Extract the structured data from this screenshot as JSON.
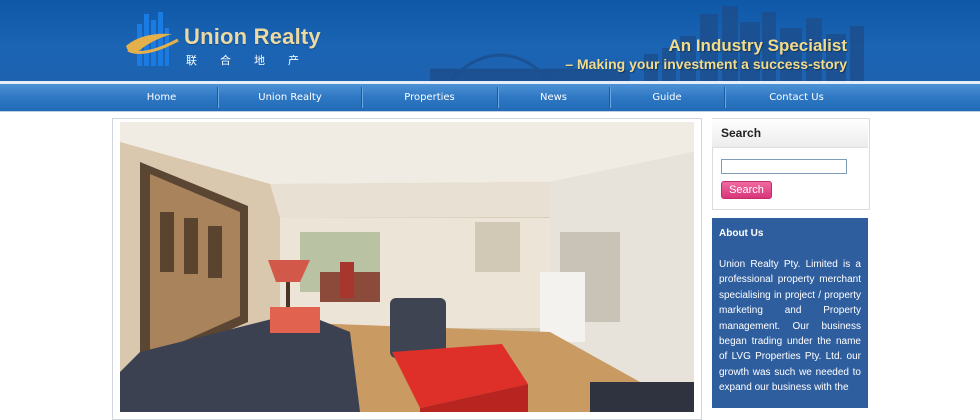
{
  "brand": {
    "name": "Union Realty",
    "chinese_name": "联合地产"
  },
  "header": {
    "tagline_title": "An Industry Specialist",
    "tagline_sub": "– Making your investment a success-story",
    "accent_color": "#ecd9a2",
    "background_color": "#1b64b4"
  },
  "nav": {
    "items": [
      {
        "label": "Home"
      },
      {
        "label": "Union Realty"
      },
      {
        "label": "Properties"
      },
      {
        "label": "News"
      },
      {
        "label": "Guide"
      },
      {
        "label": "Contact Us"
      }
    ]
  },
  "hero": {
    "image": "apartment-living-room-photo"
  },
  "search": {
    "title": "Search",
    "input_value": "",
    "button_label": "Search",
    "button_color": "#e04a8a"
  },
  "about": {
    "title": "About Us",
    "text": "Union Realty Pty. Limited is a professional property merchant specialising in project / property marketing and Property management. Our business began trading under the name of LVG Properties Pty. Ltd. our growth was such we needed to expand our business with the",
    "background_color": "#2f5e9f"
  }
}
